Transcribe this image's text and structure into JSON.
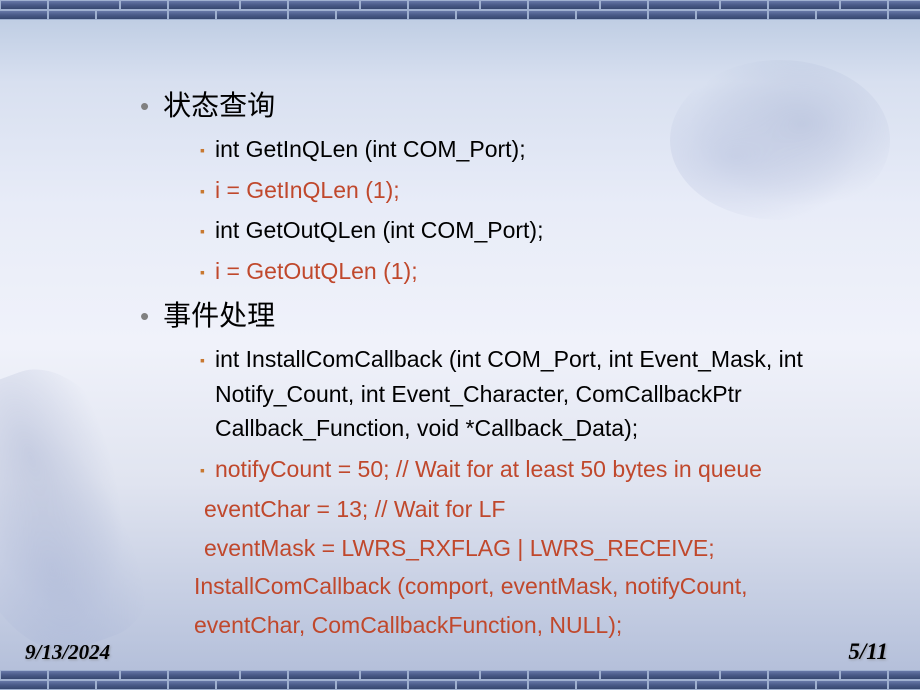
{
  "bullets": {
    "b1_title": "状态查询",
    "b1_items": [
      {
        "text": "int GetInQLen (int COM_Port);",
        "color": "black"
      },
      {
        "text": "i = GetInQLen (1);",
        "color": "orange"
      },
      {
        "text": "int GetOutQLen (int COM_Port);",
        "color": "black"
      },
      {
        "text": "i = GetOutQLen (1);",
        "color": "orange"
      }
    ],
    "b2_title": "事件处理",
    "b2_items": {
      "line_sig": "int InstallComCallback (int COM_Port, int Event_Mask, int Notify_Count, int Event_Character, ComCallbackPtr Callback_Function, void *Callback_Data);",
      "line_notify": " notifyCount = 50; // Wait for at least 50 bytes in queue",
      "line_event": "eventChar   = 13;  // Wait for LF",
      "line_mask": "eventMask   = LWRS_RXFLAG | LWRS_RECEIVE;",
      "line_install1": "InstallComCallback (comport, eventMask, notifyCount,",
      "line_install2": "eventChar, ComCallbackFunction, NULL);"
    }
  },
  "footer": {
    "date": "9/13/2024",
    "page": "5/11"
  }
}
